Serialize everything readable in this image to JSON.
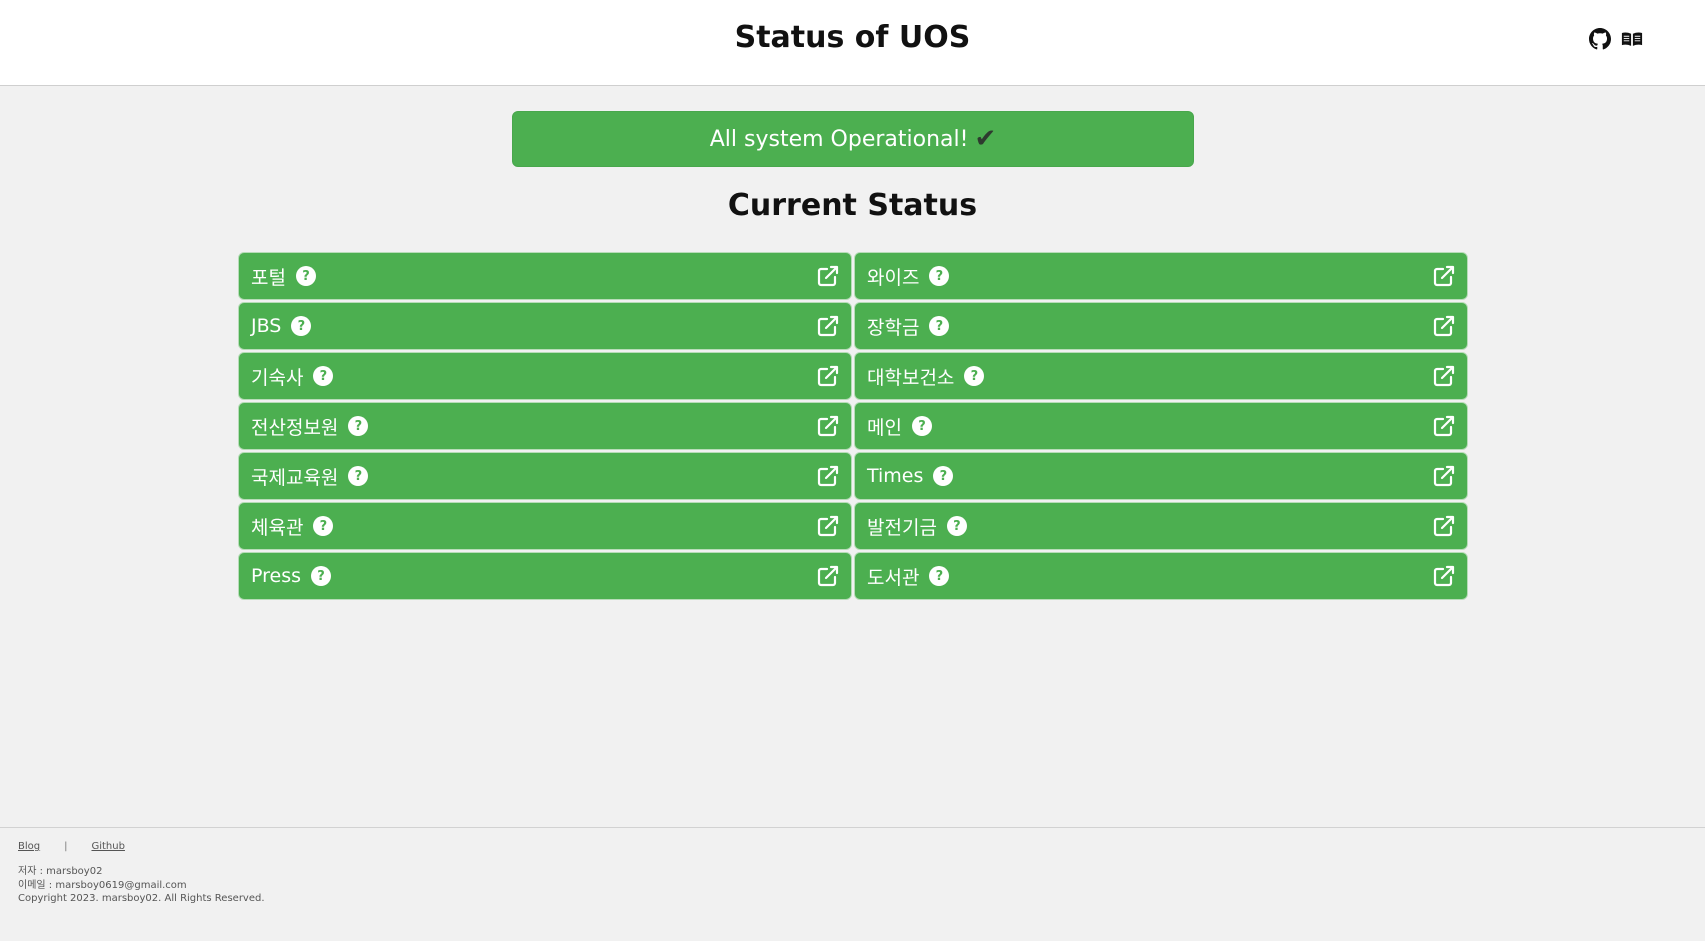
{
  "header": {
    "title": "Status of UOS",
    "icons": [
      "github-icon",
      "book-icon"
    ]
  },
  "banner": {
    "text": "All system Operational!",
    "check": "✔",
    "color": "#4caf50"
  },
  "section_title": "Current Status",
  "help_symbol": "?",
  "services": [
    {
      "label": "포털"
    },
    {
      "label": "와이즈"
    },
    {
      "label": "JBS"
    },
    {
      "label": "장학금"
    },
    {
      "label": "기숙사"
    },
    {
      "label": "대학보건소"
    },
    {
      "label": "전산정보원"
    },
    {
      "label": "메인"
    },
    {
      "label": "국제교육원"
    },
    {
      "label": "Times"
    },
    {
      "label": "체육관"
    },
    {
      "label": "발전기금"
    },
    {
      "label": "Press"
    },
    {
      "label": "도서관"
    }
  ],
  "footer": {
    "links": [
      "Blog",
      "Github"
    ],
    "separator": "|",
    "author": "저자 : marsboy02",
    "email": "이메일 : marsboy0619@gmail.com",
    "copyright": "Copyright 2023. marsboy02. All Rights Reserved."
  },
  "colors": {
    "status_ok": "#4caf50",
    "background": "#f1f1f1"
  }
}
